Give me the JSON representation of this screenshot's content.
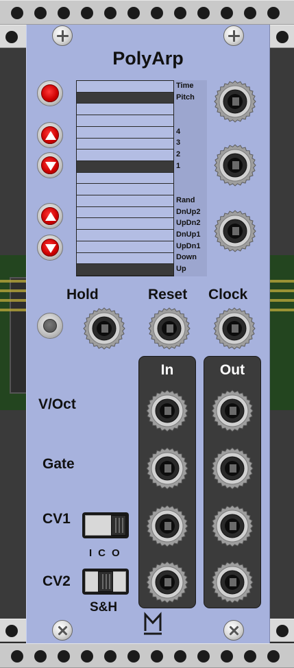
{
  "module": {
    "title": "PolyArp",
    "logo_text": "M",
    "accent_color": "#a7b2dd",
    "button_color": "#cc0000"
  },
  "display": {
    "rows": [
      {
        "label": "Time",
        "active": false
      },
      {
        "label": "Pitch",
        "active": true
      },
      {
        "label": "",
        "active": false
      },
      {
        "label": "",
        "active": false
      },
      {
        "label": "4",
        "active": false
      },
      {
        "label": "3",
        "active": false
      },
      {
        "label": "2",
        "active": false
      },
      {
        "label": "1",
        "active": true
      },
      {
        "label": "",
        "active": false
      },
      {
        "label": "",
        "active": false
      },
      {
        "label": "Rand",
        "active": false
      },
      {
        "label": "DnUp2",
        "active": false
      },
      {
        "label": "UpDn2",
        "active": false
      },
      {
        "label": "DnUp1",
        "active": false
      },
      {
        "label": "UpDn1",
        "active": false
      },
      {
        "label": "Down",
        "active": false
      },
      {
        "label": "Up",
        "active": true
      }
    ]
  },
  "controls": {
    "mode_button_icon": "red-round-button",
    "up_icon": "triangle-up-icon",
    "down_icon": "triangle-down-icon"
  },
  "labels": {
    "hold": "Hold",
    "reset": "Reset",
    "clock": "Clock",
    "in": "In",
    "out": "Out",
    "voct": "V/Oct",
    "gate": "Gate",
    "cv1": "CV1",
    "cv2": "CV2",
    "ico": "ICO",
    "sh": "S&H"
  },
  "switches": {
    "cv1_position": "O",
    "cv2_position": "C"
  }
}
